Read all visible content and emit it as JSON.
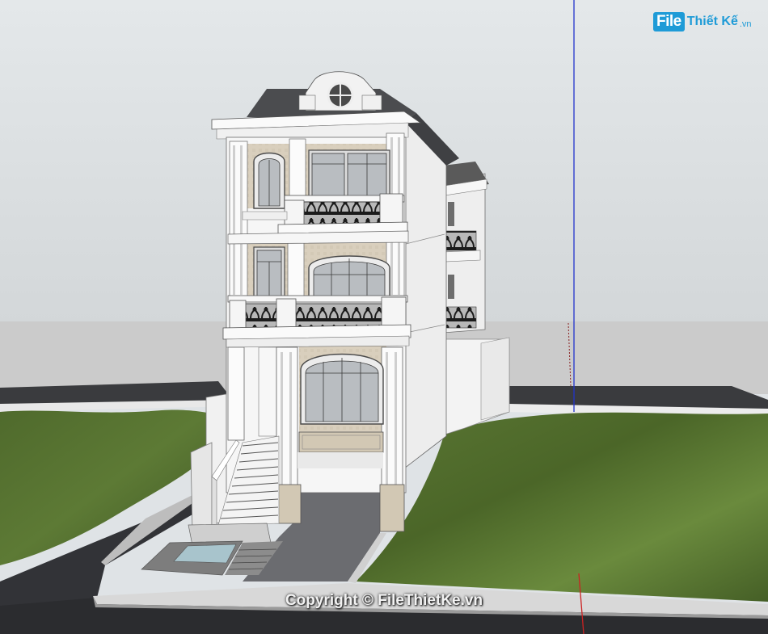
{
  "watermark": {
    "copyright": "Copyright © FileThietKe.vn"
  },
  "logo": {
    "mark": "File",
    "rest": "Thiết Kế",
    "tld": ".vn"
  },
  "colors": {
    "sky": "#dfe3e6",
    "grass": "#55722f",
    "road": "#2f3033",
    "wall": "#f4f4f4",
    "stone": "#d8cfbe",
    "roof": "#4a4a4a",
    "railing": "#2a2a2a",
    "axis_blue": "#2233cc",
    "axis_red": "#cc2222",
    "brand": "#1e9bd7"
  }
}
